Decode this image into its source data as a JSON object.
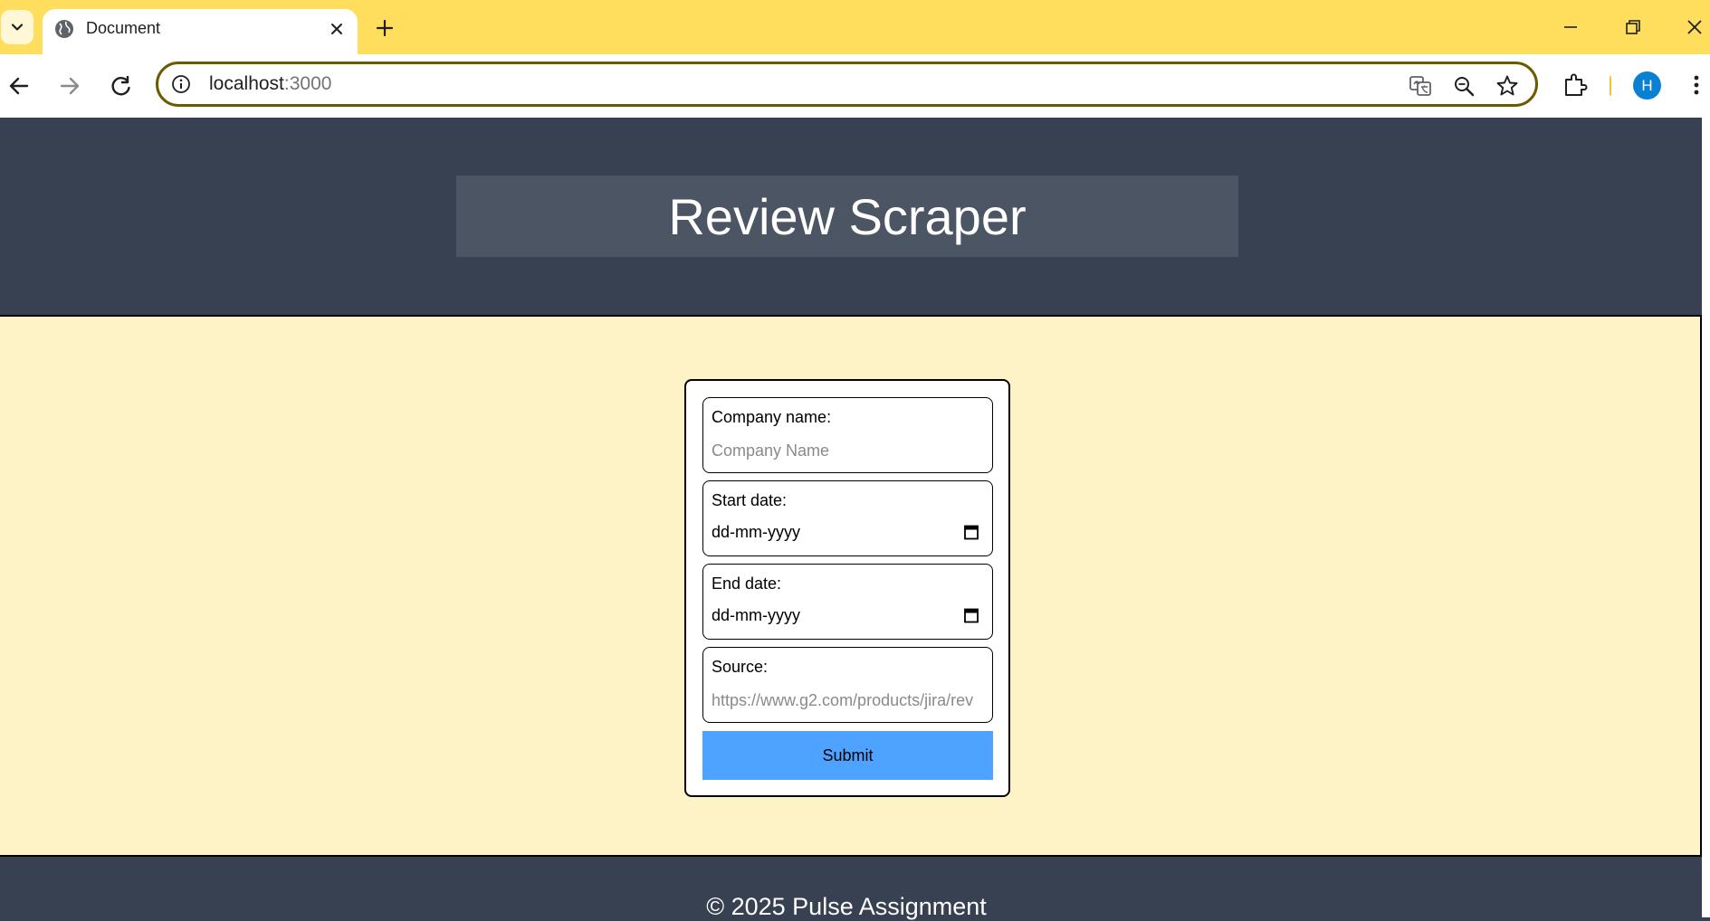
{
  "browser": {
    "tab": {
      "title": "Document"
    },
    "omnibox": {
      "host": "localhost",
      "port": ":3000"
    },
    "profile_initial": "H",
    "accent_color": "#ffde5e"
  },
  "header": {
    "title": "Review Scraper"
  },
  "form": {
    "company": {
      "label": "Company name:",
      "placeholder": "Company Name",
      "value": ""
    },
    "start_date": {
      "label": "Start date:",
      "value": "dd-mm-yyyy"
    },
    "end_date": {
      "label": "End date:",
      "value": "dd-mm-yyyy"
    },
    "source": {
      "label": "Source:",
      "placeholder": "https://www.g2.com/products/jira/rev",
      "value": ""
    },
    "submit_label": "Submit",
    "submit_color": "#4da3ff"
  },
  "footer": {
    "text": "© 2025 Pulse Assignment"
  },
  "icons": [
    "tab-search-icon",
    "globe-icon",
    "close-icon",
    "plus-icon",
    "minimize-icon",
    "restore-icon",
    "back-arrow-icon",
    "forward-arrow-icon",
    "reload-icon",
    "info-icon",
    "translate-icon",
    "zoom-icon",
    "star-icon",
    "extensions-icon",
    "more-vert-icon",
    "calendar-icon"
  ]
}
